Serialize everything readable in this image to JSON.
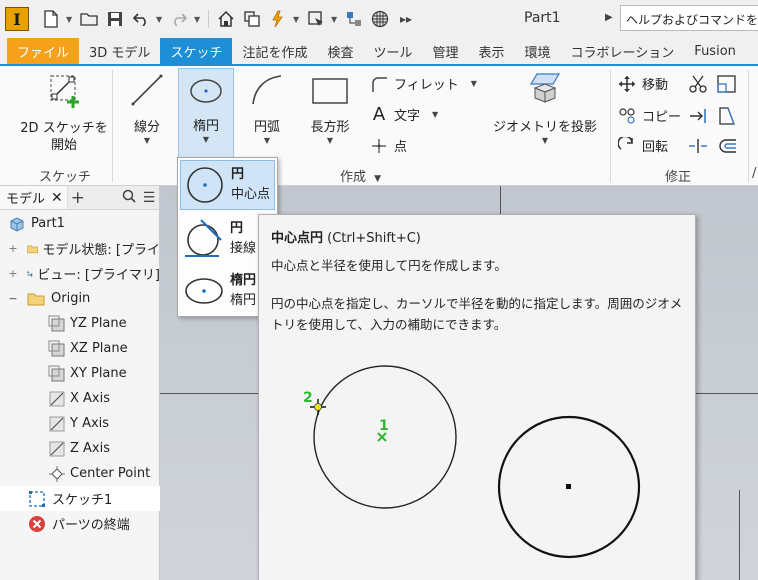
{
  "app": {
    "logo_letter": "I",
    "doc_title": "Part1",
    "help_search": "ヘルプおよびコマンドを検"
  },
  "tabs": [
    {
      "label": "ファイル"
    },
    {
      "label": "3D モデル"
    },
    {
      "label": "スケッチ"
    },
    {
      "label": "注記を作成"
    },
    {
      "label": "検査"
    },
    {
      "label": "ツール"
    },
    {
      "label": "管理"
    },
    {
      "label": "表示"
    },
    {
      "label": "環境"
    },
    {
      "label": "コラボレーション"
    },
    {
      "label": "Fusion"
    }
  ],
  "ribbon": {
    "sketch_panel": {
      "start_line1": "2D スケッチを",
      "start_line2": "開始",
      "label": "スケッチ"
    },
    "create_panel": {
      "line": "線分",
      "ellipse": "楕円",
      "arc": "円弧",
      "rectangle": "長方形",
      "fillet": "フィレット",
      "text": "文字",
      "point": "点",
      "project_geometry": "ジオメトリを投影",
      "label": "作成"
    },
    "modify_panel": {
      "move": "移動",
      "copy": "コピー",
      "rotate": "回転",
      "label": "修正"
    }
  },
  "browser": {
    "tab_label": "モデル",
    "items": [
      {
        "label": "Part1"
      },
      {
        "label": "モデル状態: [プライ"
      },
      {
        "label": "ビュー: [プライマリ]"
      },
      {
        "label": "Origin"
      },
      {
        "label": "YZ Plane"
      },
      {
        "label": "XZ Plane"
      },
      {
        "label": "XY Plane"
      },
      {
        "label": "X Axis"
      },
      {
        "label": "Y Axis"
      },
      {
        "label": "Z Axis"
      },
      {
        "label": "Center Point"
      },
      {
        "label": "スケッチ1"
      },
      {
        "label": "パーツの終端"
      }
    ]
  },
  "dropdown": {
    "items": [
      {
        "title": "円",
        "sub": "中心点"
      },
      {
        "title": "円",
        "sub": "接線"
      },
      {
        "title": "楕円",
        "sub": "楕円"
      }
    ]
  },
  "tooltip": {
    "title": "中心点円",
    "shortcut": "(Ctrl+Shift+C)",
    "desc": "中心点と半径を使用して円を作成します。",
    "long": "円の中心点を指定し、カーソルで半径を動的に指定します。周囲のジオメトリを使用して、入力の補助にできます。",
    "step1": "1",
    "step2": "2",
    "accent": "#2db82d"
  }
}
